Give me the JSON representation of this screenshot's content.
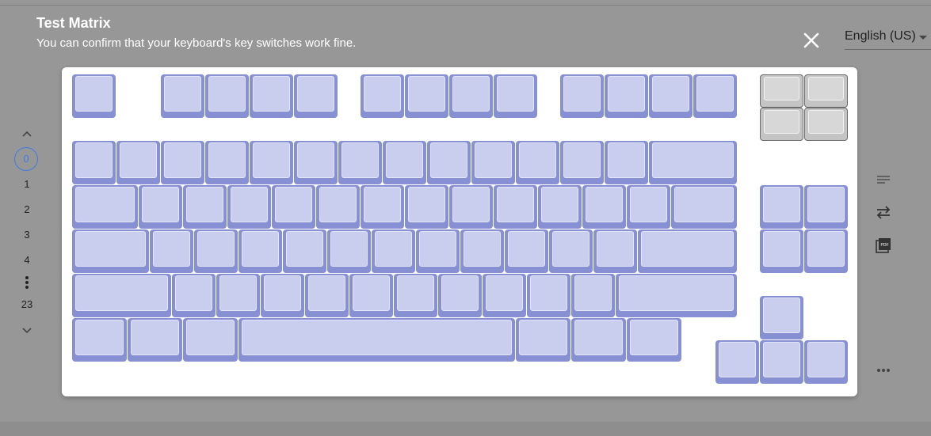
{
  "header": {
    "title": "Test Matrix",
    "subtitle": "You can confirm that your keyboard's key switches work fine."
  },
  "language": {
    "selected": "English (US)"
  },
  "layers": {
    "current": "0",
    "items": [
      "1",
      "2",
      "3",
      "4"
    ],
    "last": "23"
  },
  "colors": {
    "background": "#979797",
    "panel": "#ffffff",
    "key_untested_outer": "#8690d3",
    "key_untested_cap": "#c9cdee",
    "key_special_outer": "#c4c4c4",
    "key_special_cap": "#d7d7d7",
    "layer_current": "#3f7ce0"
  },
  "icons": {
    "close": "close-icon",
    "layer_up": "chevron-up-icon",
    "layer_down": "chevron-down-icon",
    "layer_more": "vertical-dots-icon",
    "list": "list-icon",
    "swap": "swap-arrows-icon",
    "pdf": "pdf-icon",
    "more": "horizontal-dots-icon"
  },
  "tools": {
    "pdf_glyph": "PDF"
  }
}
